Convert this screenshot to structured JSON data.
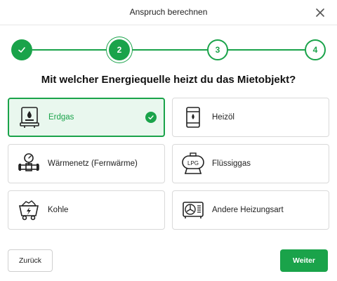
{
  "modal": {
    "title": "Anspruch berechnen",
    "close_icon": "close-icon"
  },
  "stepper": {
    "steps": [
      {
        "label": "",
        "state": "done",
        "icon": "check-icon"
      },
      {
        "label": "2",
        "state": "current"
      },
      {
        "label": "3",
        "state": "todo"
      },
      {
        "label": "4",
        "state": "todo"
      }
    ]
  },
  "question": "Mit welcher Energiequelle heizt du das Mietobjekt?",
  "options": [
    {
      "label": "Erdgas",
      "icon": "gas-boiler-icon",
      "selected": true
    },
    {
      "label": "Heizöl",
      "icon": "oil-barrel-icon",
      "selected": false
    },
    {
      "label": "Wärmenetz (Fernwärme)",
      "icon": "district-heating-icon",
      "selected": false
    },
    {
      "label": "Flüssiggas",
      "icon": "lpg-tank-icon",
      "selected": false
    },
    {
      "label": "Kohle",
      "icon": "coal-cart-icon",
      "selected": false
    },
    {
      "label": "Andere Heizungsart",
      "icon": "heat-pump-icon",
      "selected": false
    }
  ],
  "buttons": {
    "back_label": "Zurück",
    "next_label": "Weiter"
  },
  "colors": {
    "accent": "#1aa34a",
    "selected_bg": "#e9f7ee"
  }
}
